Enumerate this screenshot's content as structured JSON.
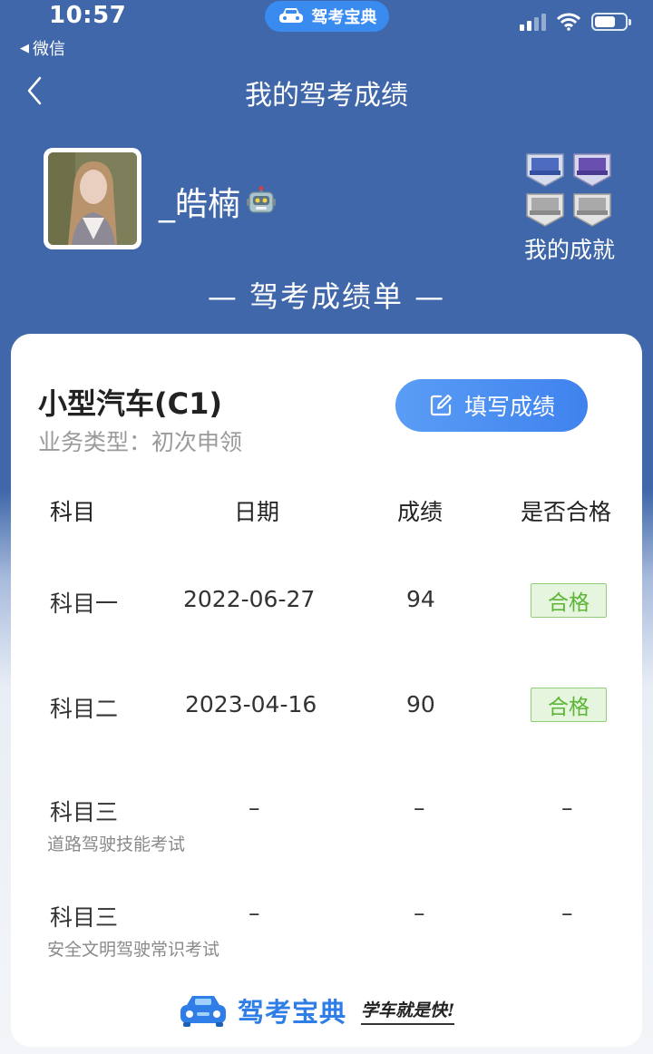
{
  "status_bar": {
    "time": "10:57",
    "back_app": "微信",
    "app_pill": "驾考宝典"
  },
  "nav": {
    "title": "我的驾考成绩"
  },
  "profile": {
    "username": "_皓楠",
    "achievements_label": "我的成就"
  },
  "section_title": "— 驾考成绩单 —",
  "card": {
    "car_type": "小型汽车(C1)",
    "business_type": "业务类型：初次申领",
    "fill_button": "填写成绩"
  },
  "table": {
    "headers": [
      "科目",
      "日期",
      "成绩",
      "是否合格"
    ],
    "rows": [
      {
        "subject": "科目一",
        "subtitle": "",
        "date": "2022-06-27",
        "score": "94",
        "result": "合格",
        "passed": true
      },
      {
        "subject": "科目二",
        "subtitle": "",
        "date": "2023-04-16",
        "score": "90",
        "result": "合格",
        "passed": true
      },
      {
        "subject": "科目三",
        "subtitle": "道路驾驶技能考试",
        "date": "–",
        "score": "–",
        "result": "–",
        "passed": false
      },
      {
        "subject": "科目三",
        "subtitle": "安全文明驾驶常识考试",
        "date": "–",
        "score": "–",
        "result": "–",
        "passed": false
      }
    ]
  },
  "footer": {
    "brand": "驾考宝典",
    "slogan": "学车就是快!"
  },
  "colors": {
    "header_bg": "#3f67aa",
    "accent": "#3f82ee",
    "pass_green": "#5cb536"
  }
}
